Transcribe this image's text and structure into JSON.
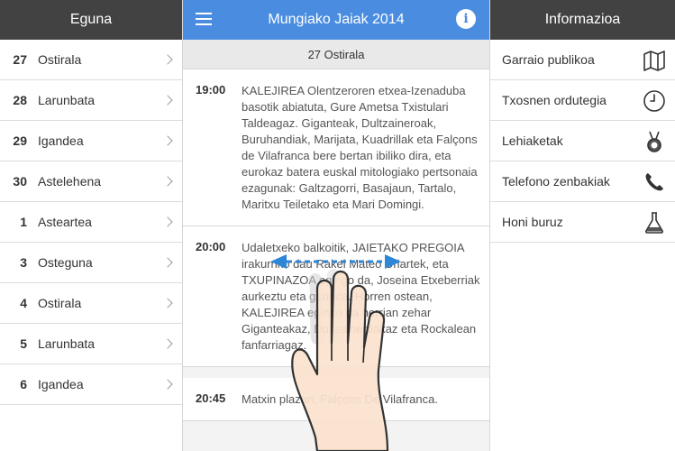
{
  "left_panel": {
    "title": "Eguna",
    "days": [
      {
        "num": "27",
        "name": "Ostirala"
      },
      {
        "num": "28",
        "name": "Larunbata"
      },
      {
        "num": "29",
        "name": "Igandea"
      },
      {
        "num": "30",
        "name": "Astelehena"
      },
      {
        "num": "1",
        "name": "Asteartea"
      },
      {
        "num": "3",
        "name": "Osteguna"
      },
      {
        "num": "4",
        "name": "Ostirala"
      },
      {
        "num": "5",
        "name": "Larunbata"
      },
      {
        "num": "6",
        "name": "Igandea"
      }
    ]
  },
  "main": {
    "title": "Mungiako Jaiak 2014",
    "info_label": "i",
    "day_heading": "27 Ostirala",
    "events": [
      {
        "time": "19:00",
        "description": "KALEJIREA Olentzeroren etxea-Izenaduba basotik abiatuta, Gure Ametsa Txistulari Taldeagaz. Giganteak, Dultzaineroak, Buruhandiak, Marijata, Kuadrillak eta Falçons de Vilafranca bere bertan ibiliko dira, eta eurokaz batera euskal mitologiako pertsonaia ezagunak: Galtzagorri, Basajaun, Tartalo, Maritxu Teiletako eta Mari Domingi."
      },
      {
        "time": "20:00",
        "description": "Udaletxeko balkoitik, JAIETAKO PREGOIA irakurriko dau Rakel Mateo Uriartek, eta TXUPINAZOA egingo da, Joseina Etxeberriak aurkeztu eta girotuta. Horren ostean, KALEJIREA egingo da herrian zehar Giganteakaz, Dultzaineroakaz eta Rockalean fanfarriagaz."
      },
      {
        "time": "20:45",
        "description": "Matxin plazan, Falçons De Vilafranca."
      }
    ]
  },
  "right_panel": {
    "title": "Informazioa",
    "items": [
      {
        "label": "Garraio publikoa",
        "icon": "map-icon"
      },
      {
        "label": "Txosnen ordutegia",
        "icon": "clock-icon"
      },
      {
        "label": "Lehiaketak",
        "icon": "medal-icon"
      },
      {
        "label": "Telefono zenbakiak",
        "icon": "phone-icon"
      },
      {
        "label": "Honi buruz",
        "icon": "flask-icon"
      }
    ]
  },
  "colors": {
    "header_dark": "#424242",
    "header_blue": "#4a8de0",
    "swipe_arrow": "#2e86d6"
  }
}
